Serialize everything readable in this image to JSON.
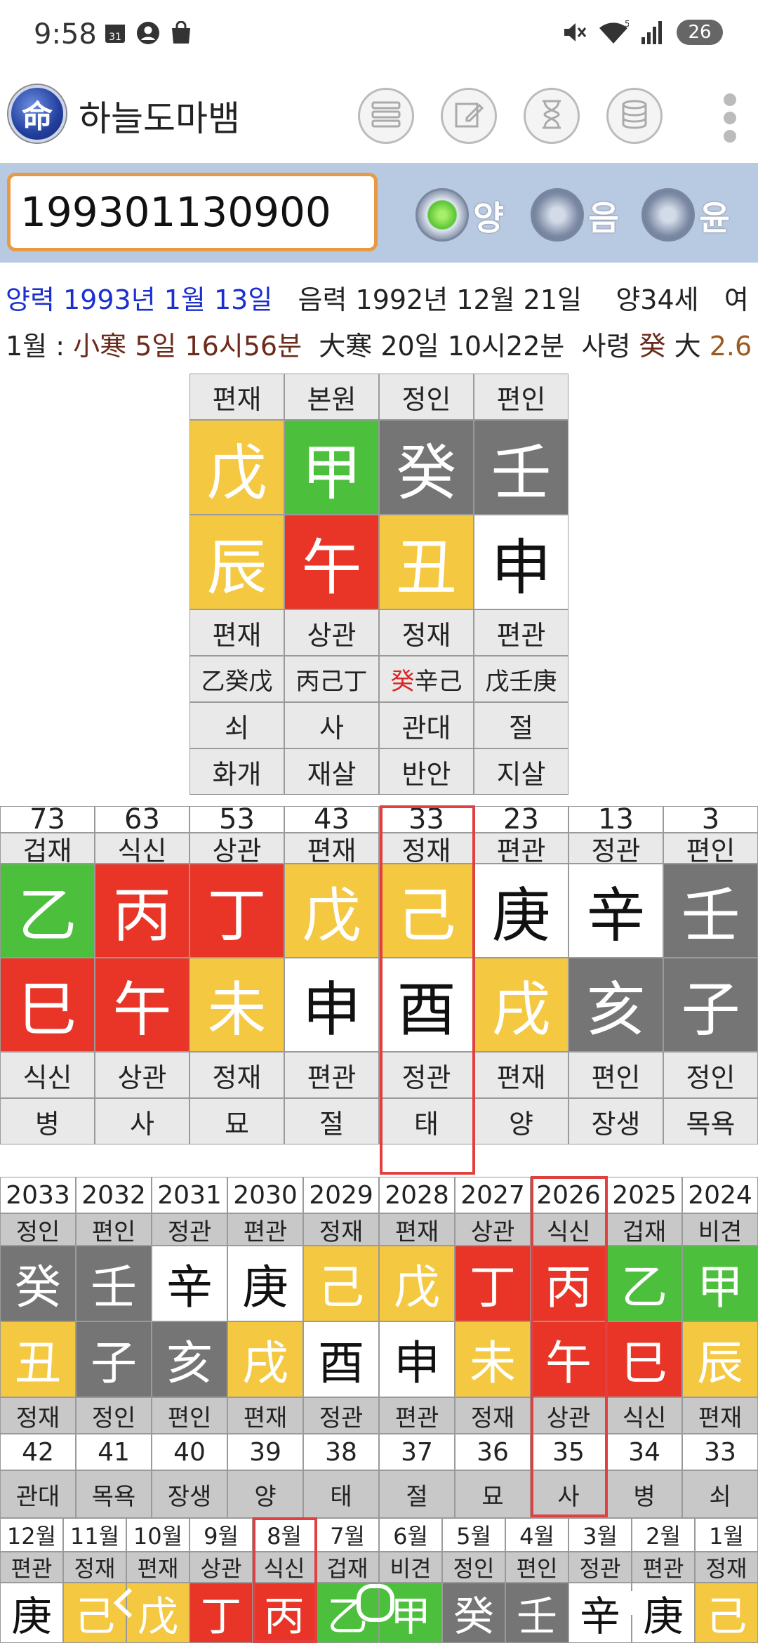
{
  "status": {
    "time": "9:58",
    "battery": "26",
    "calendar_day": "31"
  },
  "app": {
    "logo_char": "命",
    "title": "하늘도마뱀"
  },
  "toolbar": {
    "icons": [
      "list-icon",
      "edit-icon",
      "hourglass-icon",
      "database-icon",
      "more-icon"
    ]
  },
  "input": {
    "birth_value": "199301130900"
  },
  "radios": [
    {
      "label": "양",
      "selected": true
    },
    {
      "label": "음",
      "selected": false
    },
    {
      "label": "윤",
      "selected": false
    }
  ],
  "info": {
    "solar": "양력 1993년 1월 13일",
    "lunar": "음력 1992년 12월 21일",
    "age": "양34세",
    "gender": "여",
    "month": "1월 :",
    "term1": "小寒 5일 16시56분",
    "term2": "大寒 20일 10시22분",
    "saryeong": "사령",
    "sr_char": "癸",
    "sr_big": "大",
    "sr_num": "2.6"
  },
  "pillars": {
    "top": [
      "편재",
      "본원",
      "정인",
      "편인"
    ],
    "stems": [
      "戊",
      "甲",
      "癸",
      "壬"
    ],
    "branches": [
      "辰",
      "午",
      "丑",
      "申"
    ],
    "ten": [
      "편재",
      "상관",
      "정재",
      "편관"
    ],
    "hidden": [
      {
        "a": "乙癸戊"
      },
      {
        "a": "丙己丁"
      },
      {
        "red": "癸",
        "a": "辛己"
      },
      {
        "a": "戊壬庚"
      }
    ],
    "stage": [
      "쇠",
      "사",
      "관대",
      "절"
    ],
    "spirit": [
      "화개",
      "재살",
      "반안",
      "지살"
    ]
  },
  "daeun": {
    "ages": [
      "73",
      "63",
      "53",
      "43",
      "33",
      "23",
      "13",
      "3"
    ],
    "top": [
      "겁재",
      "식신",
      "상관",
      "편재",
      "정재",
      "편관",
      "정관",
      "편인"
    ],
    "stems": [
      "乙",
      "丙",
      "丁",
      "戊",
      "己",
      "庚",
      "辛",
      "壬"
    ],
    "branches": [
      "巳",
      "午",
      "未",
      "申",
      "酉",
      "戌",
      "亥",
      "子"
    ],
    "ten": [
      "식신",
      "상관",
      "정재",
      "편관",
      "정관",
      "편재",
      "편인",
      "정인"
    ],
    "stage": [
      "병",
      "사",
      "묘",
      "절",
      "태",
      "양",
      "장생",
      "목욕"
    ]
  },
  "seun": {
    "years": [
      "2033",
      "2032",
      "2031",
      "2030",
      "2029",
      "2028",
      "2027",
      "2026",
      "2025",
      "2024"
    ],
    "top": [
      "정인",
      "편인",
      "정관",
      "편관",
      "정재",
      "편재",
      "상관",
      "식신",
      "겁재",
      "비견"
    ],
    "stems": [
      "癸",
      "壬",
      "辛",
      "庚",
      "己",
      "戊",
      "丁",
      "丙",
      "乙",
      "甲"
    ],
    "branches": [
      "丑",
      "子",
      "亥",
      "戌",
      "酉",
      "申",
      "未",
      "午",
      "巳",
      "辰"
    ],
    "ten": [
      "정재",
      "정인",
      "편인",
      "편재",
      "정관",
      "편관",
      "정재",
      "상관",
      "식신",
      "편재"
    ],
    "ages": [
      "42",
      "41",
      "40",
      "39",
      "38",
      "37",
      "36",
      "35",
      "34",
      "33"
    ],
    "stage": [
      "관대",
      "목욕",
      "장생",
      "양",
      "태",
      "절",
      "묘",
      "사",
      "병",
      "쇠"
    ]
  },
  "wolun": {
    "months": [
      "12월",
      "11월",
      "10월",
      "9월",
      "8월",
      "7월",
      "6월",
      "5월",
      "4월",
      "3월",
      "2월",
      "1월"
    ],
    "top": [
      "편관",
      "정재",
      "편재",
      "상관",
      "식신",
      "겁재",
      "비견",
      "정인",
      "편인",
      "정관",
      "편관",
      "정재"
    ],
    "stems": [
      "庚",
      "己",
      "戊",
      "丁",
      "丙",
      "乙",
      "甲",
      "癸",
      "壬",
      "辛",
      "庚",
      "己"
    ]
  },
  "colors": {
    "yellow": "#f5c842",
    "green": "#4cbf3d",
    "gray": "#757575",
    "red": "#e83527",
    "white": "#ffffff",
    "highlight": "#e04040"
  }
}
